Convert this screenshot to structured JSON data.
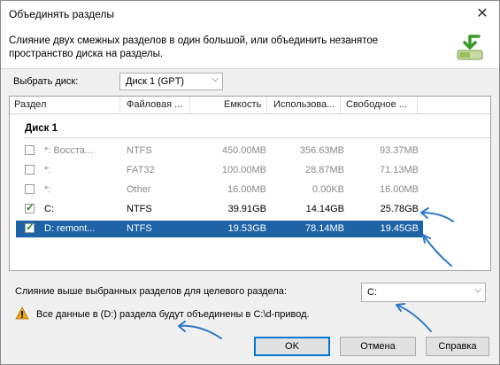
{
  "window": {
    "title": "Объединять разделы",
    "close_glyph": "✕"
  },
  "header": {
    "description": "Слияние двух смежных разделов в один большой, или объединить незанятое пространство диска на разделы.",
    "icon": "merge-partition-icon"
  },
  "disk_select": {
    "label": "Выбрать диск:",
    "value": "Диск 1 (GPT)"
  },
  "table": {
    "columns": [
      "Раздел",
      "Файловая ...",
      "Емкость",
      "Использова...",
      "Свободное ..."
    ],
    "group_label": "Диск 1",
    "rows": [
      {
        "checked": false,
        "enabled": false,
        "selected": false,
        "name": "*: Восста...",
        "fs": "NTFS",
        "capacity": "450.00MB",
        "used": "356.63MB",
        "free": "93.37MB"
      },
      {
        "checked": false,
        "enabled": false,
        "selected": false,
        "name": "*:",
        "fs": "FAT32",
        "capacity": "100.00MB",
        "used": "28.87MB",
        "free": "71.13MB"
      },
      {
        "checked": false,
        "enabled": false,
        "selected": false,
        "name": "*:",
        "fs": "Other",
        "capacity": "16.00MB",
        "used": "0.00KB",
        "free": "16.00MB"
      },
      {
        "checked": true,
        "enabled": true,
        "selected": false,
        "name": "C:",
        "fs": "NTFS",
        "capacity": "39.91GB",
        "used": "14.14GB",
        "free": "25.78GB"
      },
      {
        "checked": true,
        "enabled": true,
        "selected": true,
        "name": "D:  remont...",
        "fs": "NTFS",
        "capacity": "19.53GB",
        "used": "78.14MB",
        "free": "19.45GB"
      }
    ]
  },
  "target": {
    "label": "Слияние выше выбранных разделов для целевого раздела:",
    "value": "C:"
  },
  "warning": {
    "icon": "warning-icon",
    "text": "Все данные в (D:) раздела будут объединены в C:\\d-привод."
  },
  "buttons": {
    "ok": "OK",
    "cancel": "Отмена",
    "help": "Справка"
  },
  "colors": {
    "selection": "#1e63a6",
    "annotation_arrow": "#2f78c8",
    "check": "#2a8a2a",
    "warning": "#e8a317"
  }
}
